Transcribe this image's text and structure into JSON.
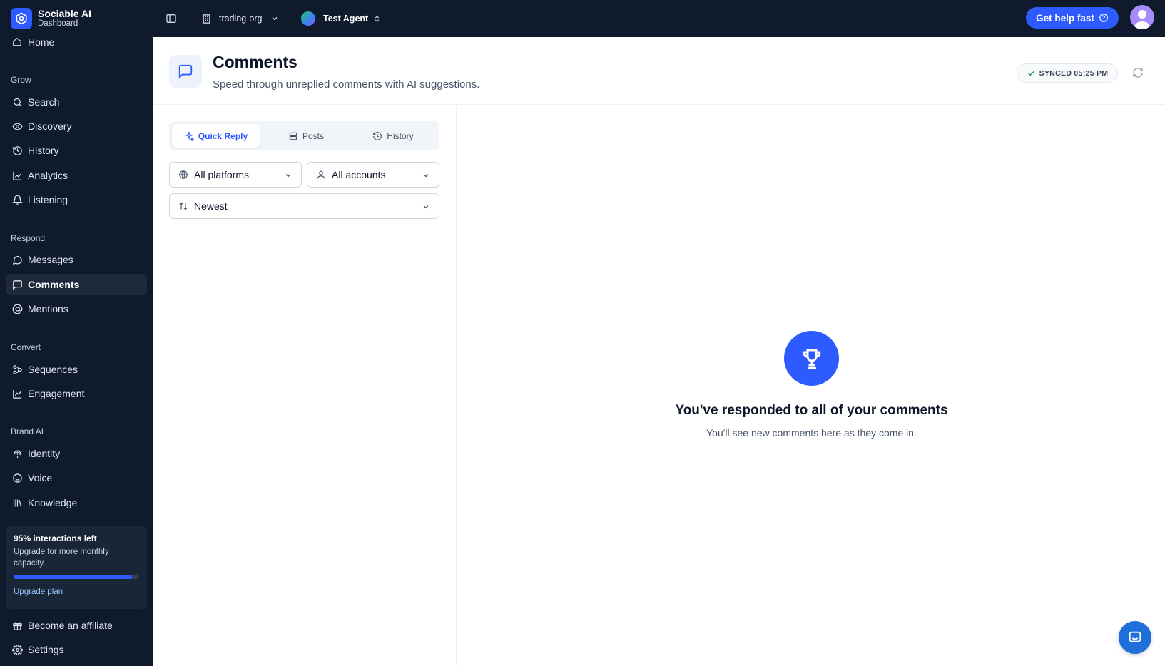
{
  "brand": {
    "name": "Sociable AI",
    "subtitle": "Dashboard"
  },
  "sidebar": {
    "partial_item": "Home",
    "sections": [
      {
        "label": "Grow",
        "items": [
          {
            "label": "Search",
            "icon": "search-icon"
          },
          {
            "label": "Discovery",
            "icon": "eye-icon"
          },
          {
            "label": "History",
            "icon": "history-icon"
          },
          {
            "label": "Analytics",
            "icon": "chart-line-icon"
          },
          {
            "label": "Listening",
            "icon": "bell-icon"
          }
        ]
      },
      {
        "label": "Respond",
        "items": [
          {
            "label": "Messages",
            "icon": "message-circle-icon"
          },
          {
            "label": "Comments",
            "icon": "message-square-icon",
            "active": true
          },
          {
            "label": "Mentions",
            "icon": "at-sign-icon"
          }
        ]
      },
      {
        "label": "Convert",
        "items": [
          {
            "label": "Sequences",
            "icon": "workflow-icon"
          },
          {
            "label": "Engagement",
            "icon": "trend-icon"
          }
        ]
      },
      {
        "label": "Brand AI",
        "items": [
          {
            "label": "Identity",
            "icon": "fingerprint-icon"
          },
          {
            "label": "Voice",
            "icon": "smile-icon"
          },
          {
            "label": "Knowledge",
            "icon": "library-icon"
          }
        ]
      }
    ],
    "usage": {
      "title": "95% interactions left",
      "description": "Upgrade for more monthly capacity.",
      "percent_left": 95,
      "link": "Upgrade plan"
    },
    "footer": [
      {
        "label": "Become an affiliate",
        "icon": "gift-icon"
      },
      {
        "label": "Settings",
        "icon": "settings-icon"
      }
    ]
  },
  "topbar": {
    "org": "trading-org",
    "agent": "Test Agent",
    "help_button": "Get help fast"
  },
  "header": {
    "title": "Comments",
    "subtitle": "Speed through unreplied comments with AI suggestions.",
    "sync_status": "SYNCED 05:25 PM"
  },
  "tabs": [
    {
      "label": "Quick Reply",
      "active": true
    },
    {
      "label": "Posts"
    },
    {
      "label": "History"
    }
  ],
  "filters": {
    "platform": "All platforms",
    "account": "All accounts",
    "sort": "Newest"
  },
  "empty_state": {
    "title": "You've responded to all of your comments",
    "subtitle": "You'll see new comments here as they come in."
  },
  "colors": {
    "accent": "#2d5bff",
    "sidebar_bg": "#0f1b2d"
  }
}
